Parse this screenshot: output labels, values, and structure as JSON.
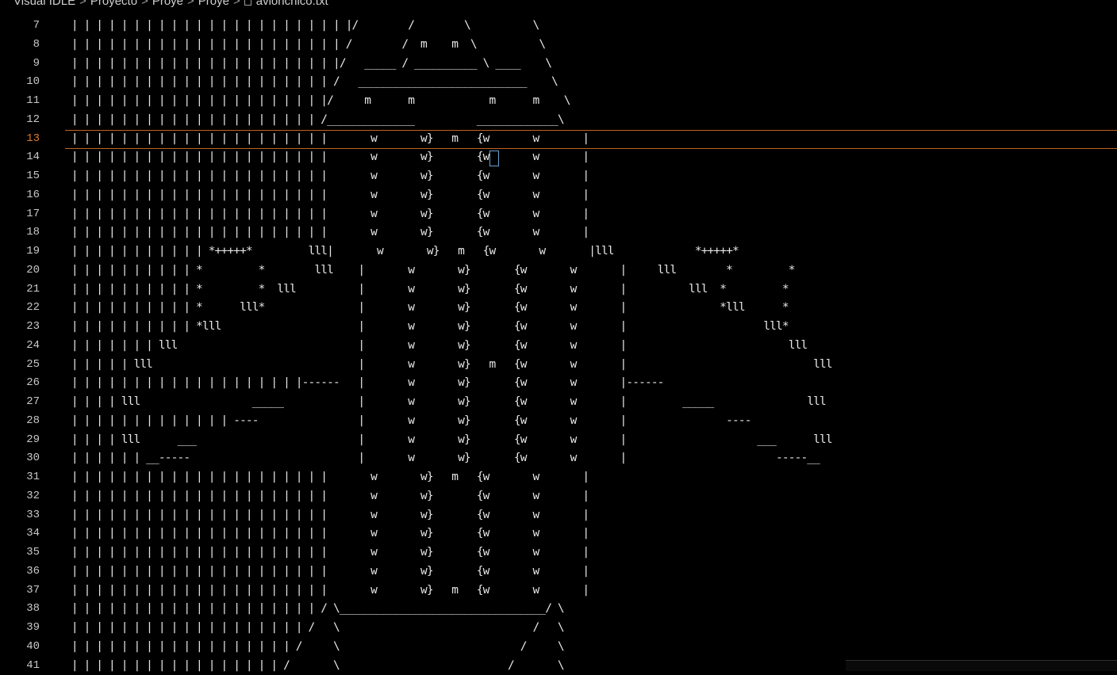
{
  "breadcrumb": {
    "items": [
      "Visual IDLE",
      "Proyecto",
      "Proye",
      "Proye"
    ],
    "separator": ">",
    "file": "avionchico.txt"
  },
  "editor": {
    "active_line": 13,
    "line_numbers": [
      "7",
      "8",
      "9",
      "10",
      "11",
      "12",
      "13",
      "14",
      "15",
      "16",
      "17",
      "18",
      "19",
      "20",
      "21",
      "22",
      "23",
      "24",
      "25",
      "26",
      "27",
      "28",
      "29",
      "30",
      "31",
      "32",
      "33",
      "34",
      "35",
      "36",
      "37",
      "38",
      "39",
      "40",
      "41"
    ],
    "lines": [
      " | | | | | | | | | | | | | | | | | | | | | | |/        /        \\          \\",
      " | | | | | | | | | | | | | | | | | | | | | | /        /  m    m  \\          \\",
      " | | | | | | | | | | | | | | | | | | | | | |/   _____ / __________ \\ ____    \\",
      " | | | | | | | | | | | | | | | | | | | | | /   ___________________________    \\",
      " | | | | | | | | | | | | | | | | | | | | |/     m      m            m      m    \\",
      " | | | | | | | | | | | | | | | | | | | | /______________          _____________\\",
      " | | | | | | | | | | | | | | | | | | | | |       w       w}   m   {w       w       |",
      " | | | | | | | | | | | | | | | | | | | | |       w       w}       {w       w       |",
      " | | | | | | | | | | | | | | | | | | | | |       w       w}       {w       w       |",
      " | | | | | | | | | | | | | | | | | | | | |       w       w}       {w       w       |",
      " | | | | | | | | | | | | | | | | | | | | |       w       w}       {w       w       |",
      " | | | | | | | | | | | | | | | | | | | | |       w       w}       {w       w       |",
      " | | | | | | | | | | | *+++++*         lll|       w       w}   m   {w       w       |lll             *+++++*",
      " | | | | | | | | | | *         *        lll    |       w       w}       {w       w       |     lll        *         *",
      " | | | | | | | | | | *         *  lll          |       w       w}       {w       w       |          lll  *         *",
      " | | | | | | | | | | *      lll*               |       w       w}       {w       w       |               *lll      *",
      " | | | | | | | | | | *lll                      |       w       w}       {w       w       |                      lll*",
      " | | | | | | | lll                             |       w       w}       {w       w       |                          lll",
      " | | | | | lll                                 |       w       w}   m   {w       w       |                              lll",
      " | | | | | | | | | | | | | | | | | | |------   |       w       w}       {w       w       |------",
      " | | | | lll                  _____            |       w       w}       {w       w       |         _____               lll",
      " | | | | | | | | | | | | | ----                |       w       w}       {w       w       |                ----",
      " | | | | lll      ___                          |       w       w}       {w       w       |                     ___      lll",
      " | | | | | | __-----                           |       w       w}       {w       w       |                        -----__",
      " | | | | | | | | | | | | | | | | | | | | |       w       w}   m   {w       w       |",
      " | | | | | | | | | | | | | | | | | | | | |       w       w}       {w       w       |",
      " | | | | | | | | | | | | | | | | | | | | |       w       w}       {w       w       |",
      " | | | | | | | | | | | | | | | | | | | | |       w       w}       {w       w       |",
      " | | | | | | | | | | | | | | | | | | | | |       w       w}       {w       w       |",
      " | | | | | | | | | | | | | | | | | | | | |       w       w}       {w       w       |",
      " | | | | | | | | | | | | | | | | | | | | |       w       w}   m   {w       w       |",
      " | | | | | | | | | | | | | | | | | | | | / \\_________________________________/ \\",
      " | | | | | | | | | | | | | | | | | | | /   \\                               /   \\",
      " | | | | | | | | | | | | | | | | | | /     \\                             /     \\",
      " | | | | | | | | | | | | | | | | | /       \\                           /       \\"
    ]
  }
}
